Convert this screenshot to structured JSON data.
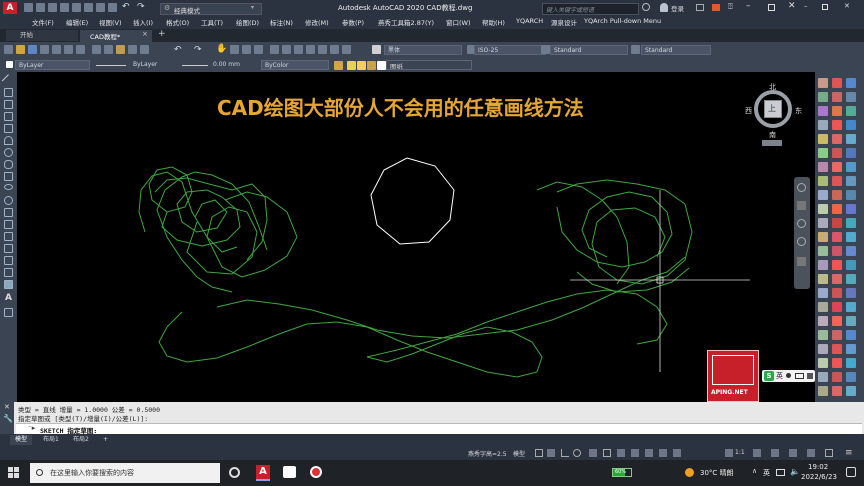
{
  "app": {
    "title": "Autodesk AutoCAD 2020   CAD教程.dwg",
    "workspace": "经典模式",
    "search_placeholder": "键入关键字或短语",
    "login": "登录"
  },
  "menu": [
    "文件(F)",
    "编辑(E)",
    "视图(V)",
    "插入(I)",
    "格式(O)",
    "工具(T)",
    "绘图(D)",
    "标注(N)",
    "修改(M)",
    "参数(P)",
    "燕秀工具箱2.87(Y)",
    "窗口(W)",
    "帮助(H)",
    "YQARCH",
    "源泉设计",
    "YQArch Pull-down Menu"
  ],
  "tabs": [
    {
      "label": "开始",
      "active": false
    },
    {
      "label": "CAD教程*",
      "active": true
    }
  ],
  "styles": {
    "text_style": "黑体",
    "dim_style": "ISO-25",
    "table_style": "Standard",
    "mleader_style": "Standard"
  },
  "properties": {
    "layer": "ByLayer",
    "linetype": "ByLayer",
    "lineweight": "0.00 mm",
    "color": "ByColor",
    "layer_name": "图纸"
  },
  "drawing": {
    "heading": "CAD绘图大部份人不会用的任意画线方法",
    "heading_color": "#e6a732",
    "sketch_color": "#3fa63f",
    "polygon_color": "#ffffff"
  },
  "viewcube": {
    "north": "北",
    "south": "南",
    "east": "东",
    "west": "西",
    "top": "上"
  },
  "watermark": {
    "url": "APING.NET",
    "ime_label": "英"
  },
  "command": {
    "line1": "类型 = 直线  增量 = 1.0000  公差 = 0.5000",
    "line2": "指定草图或 [类型(T)/增量(I)/公差(L)]:",
    "prompt": "SKETCH 指定草图:"
  },
  "layouts": [
    "模型",
    "布局1",
    "布局2"
  ],
  "status": {
    "text_height": "燕秀字高=2.5",
    "model": "模型",
    "scale": "1:1"
  },
  "taskbar": {
    "search_placeholder": "在这里输入你要搜索的内容",
    "battery": "60%",
    "weather": "30°C 晴朗",
    "ime": "英",
    "time": "19:02",
    "date": "2022/6/23"
  }
}
